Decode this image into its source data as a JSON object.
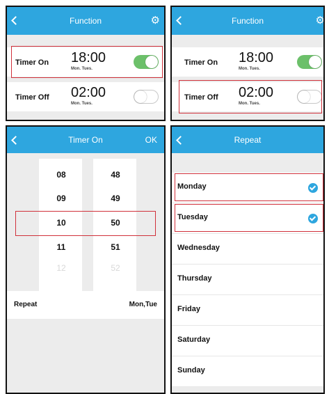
{
  "panel1": {
    "title": "Function",
    "timer_on": {
      "label": "Timer On",
      "time": "18:00",
      "days": "Mon. Tues.",
      "enabled": true
    },
    "timer_off": {
      "label": "Timer Off",
      "time": "02:00",
      "days": "Mon. Tues.",
      "enabled": false
    }
  },
  "panel2": {
    "title": "Function",
    "timer_on": {
      "label": "Timer On",
      "time": "18:00",
      "days": "Mon. Tues.",
      "enabled": true
    },
    "timer_off": {
      "label": "Timer Off",
      "time": "02:00",
      "days": "Mon. Tues.",
      "enabled": false
    }
  },
  "panel3": {
    "title": "Timer On",
    "ok_label": "OK",
    "hours": [
      "08",
      "09",
      "10",
      "11",
      "12"
    ],
    "minutes": [
      "48",
      "49",
      "50",
      "51",
      "52"
    ],
    "selected_hour": "10",
    "selected_minute": "50",
    "repeat_label": "Repeat",
    "repeat_value": "Mon,Tue"
  },
  "panel4": {
    "title": "Repeat",
    "days": [
      {
        "name": "Monday",
        "checked": true
      },
      {
        "name": "Tuesday",
        "checked": true
      },
      {
        "name": "Wednesday",
        "checked": false
      },
      {
        "name": "Thursday",
        "checked": false
      },
      {
        "name": "Friday",
        "checked": false
      },
      {
        "name": "Saturday",
        "checked": false
      },
      {
        "name": "Sunday",
        "checked": false
      }
    ]
  },
  "colors": {
    "header": "#2ea6df",
    "toggle_on": "#6cc06a",
    "highlight": "#d0303a",
    "check": "#2ea6df"
  }
}
